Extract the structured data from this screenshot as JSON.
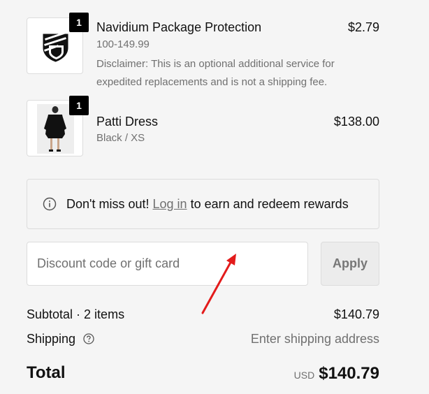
{
  "items": [
    {
      "title": "Navidium Package Protection",
      "variant": "100-149.99",
      "disclaimer": "Disclaimer: This is an optional additional service for expedited replacements and is not a shipping fee.",
      "price": "$2.79",
      "quantity": "1",
      "icon": "shield-logo-icon"
    },
    {
      "title": "Patti Dress",
      "variant": "Black / XS",
      "price": "$138.00",
      "quantity": "1",
      "image": "dress-model-image"
    }
  ],
  "rewards": {
    "prefix": "Don't miss out!",
    "link_label": "Log in",
    "suffix": "to earn and redeem rewards",
    "icon": "info-icon"
  },
  "discount": {
    "placeholder": "Discount code or gift card",
    "apply_label": "Apply"
  },
  "summary": {
    "subtotal_label": "Subtotal · 2 items",
    "subtotal_value": "$140.79",
    "shipping_label": "Shipping",
    "shipping_value": "Enter shipping address",
    "total_label": "Total",
    "currency": "USD",
    "total_value": "$140.79"
  },
  "annotation": {
    "color": "#e31b1b",
    "icon": "red-arrow-annotation"
  }
}
